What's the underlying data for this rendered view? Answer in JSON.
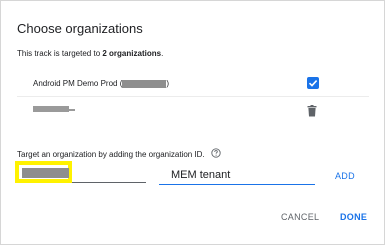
{
  "dialog": {
    "title": "Choose organizations",
    "subtitle_prefix": "This track is targeted to ",
    "subtitle_count": "2 organizations",
    "subtitle_suffix": "."
  },
  "organizations": [
    {
      "label_prefix": "Android PM Demo Prod (",
      "label_suffix": ")",
      "control": "checkbox",
      "checked": true
    },
    {
      "label_prefix": "",
      "label_suffix": "",
      "control": "trash-icon"
    }
  ],
  "target": {
    "label": "Target an organization by adding the organization ID.",
    "help_icon": "help-circle-icon",
    "org_id_value": "",
    "name_value": "MEM tenant",
    "add_label": "ADD"
  },
  "actions": {
    "cancel_label": "CANCEL",
    "done_label": "DONE"
  },
  "colors": {
    "accent": "#1a73e8",
    "highlight": "#fff200",
    "redaction": "#8e8e8e"
  }
}
